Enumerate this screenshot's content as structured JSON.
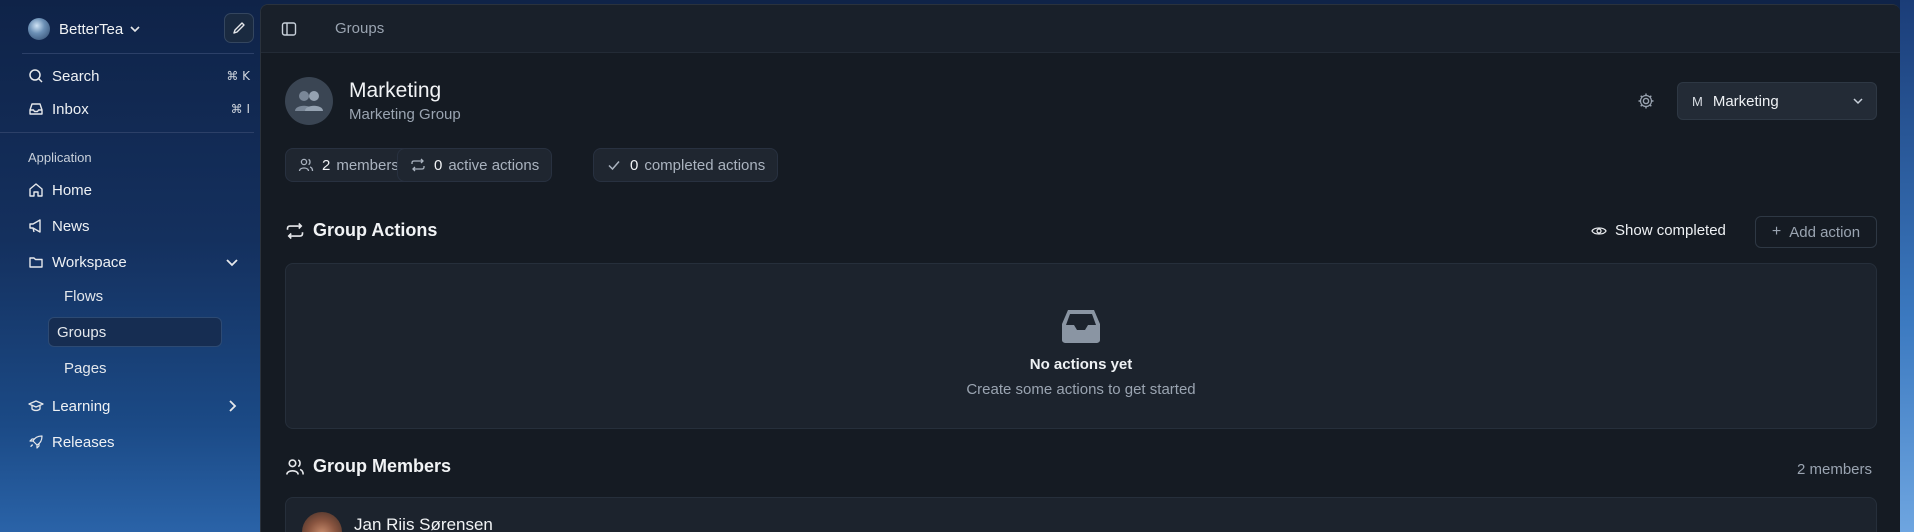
{
  "workspace": {
    "name": "BetterTea"
  },
  "sidebar": {
    "search": {
      "label": "Search",
      "shortcut": "⌘ K"
    },
    "inbox": {
      "label": "Inbox",
      "shortcut": "⌘ I"
    },
    "section_label": "Application",
    "items": [
      {
        "label": "Home"
      },
      {
        "label": "News"
      },
      {
        "label": "Workspace"
      },
      {
        "label": "Learning"
      },
      {
        "label": "Releases"
      }
    ],
    "workspace_children": [
      {
        "label": "Flows"
      },
      {
        "label": "Groups"
      },
      {
        "label": "Pages"
      }
    ]
  },
  "header": {
    "breadcrumb": "Groups"
  },
  "group": {
    "title": "Marketing",
    "subtitle": "Marketing Group",
    "selector": {
      "badge": "M",
      "value": "Marketing"
    }
  },
  "stats": [
    {
      "count": "2",
      "label": "members"
    },
    {
      "count": "0",
      "label": "active actions"
    },
    {
      "count": "0",
      "label": "completed actions"
    }
  ],
  "actions": {
    "title": "Group Actions",
    "show_completed": "Show completed",
    "add_action": "Add action",
    "empty_title": "No actions yet",
    "empty_subtitle": "Create some actions to get started"
  },
  "members": {
    "title": "Group Members",
    "count_label": "2 members",
    "list": [
      {
        "name": "Jan Riis Sørensen"
      }
    ]
  },
  "icons": [
    "pencil-icon",
    "search-icon",
    "inbox-icon",
    "home-icon",
    "megaphone-icon",
    "folder-icon",
    "graduation-cap-icon",
    "rocket-icon",
    "sidebar-toggle-icon",
    "users-icon",
    "repeat-icon",
    "check-icon",
    "gear-icon",
    "eye-icon",
    "plus-icon",
    "tray-icon"
  ]
}
